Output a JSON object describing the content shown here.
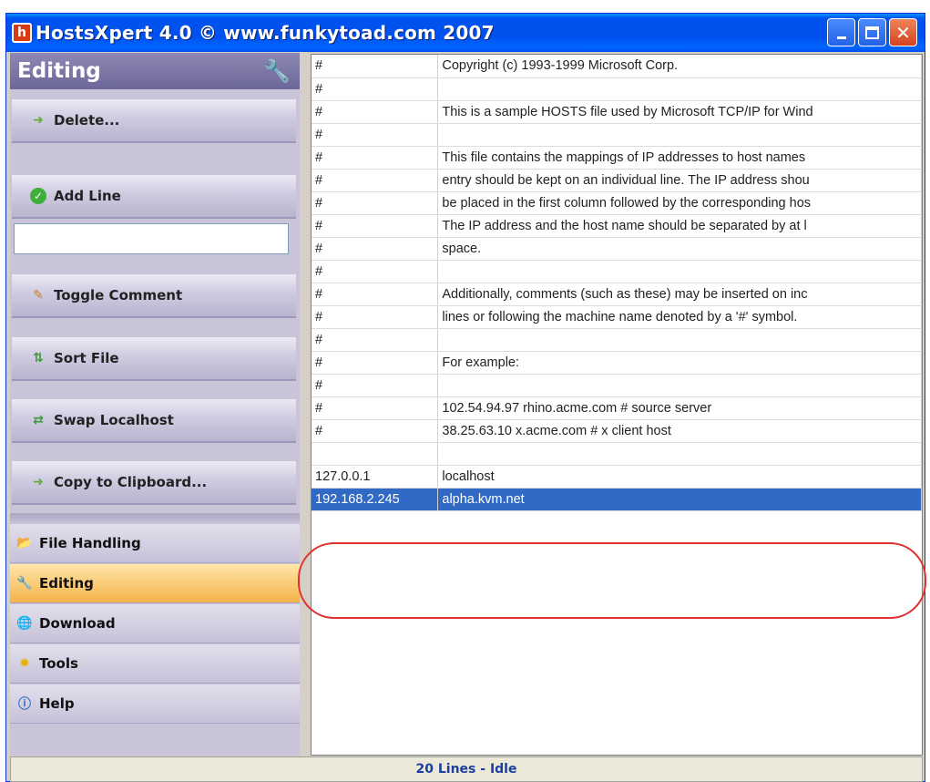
{
  "window": {
    "title": "HostsXpert 4.0 © www.funkytoad.com 2007"
  },
  "sidebar": {
    "header": "Editing",
    "actions": [
      {
        "label": "Delete...",
        "icon": "arrow-right-icon"
      },
      {
        "label": "Add Line",
        "icon": "check-circle-icon"
      },
      {
        "label": "Toggle Comment",
        "icon": "pencil-icon"
      },
      {
        "label": "Sort File",
        "icon": "sort-icon"
      },
      {
        "label": "Swap Localhost",
        "icon": "swap-icon"
      },
      {
        "label": "Copy to Clipboard...",
        "icon": "arrow-right-icon"
      }
    ],
    "add_input_value": "",
    "nav": [
      {
        "label": "File Handling",
        "icon": "folder-icon"
      },
      {
        "label": "Editing",
        "icon": "wrench-icon",
        "active": true
      },
      {
        "label": "Download",
        "icon": "globe-icon"
      },
      {
        "label": "Tools",
        "icon": "star-icon"
      },
      {
        "label": "Help",
        "icon": "help-icon"
      }
    ]
  },
  "hosts_rows": [
    [
      "#",
      "Copyright (c) 1993-1999 Microsoft Corp."
    ],
    [
      "#",
      ""
    ],
    [
      "#",
      "This is a sample HOSTS file used by Microsoft TCP/IP for Wind"
    ],
    [
      "#",
      ""
    ],
    [
      "#",
      "This file contains the mappings of IP addresses to host names"
    ],
    [
      "#",
      "entry should be kept on an individual line. The IP address shou"
    ],
    [
      "#",
      "be placed in the first column followed by the corresponding hos"
    ],
    [
      "#",
      "The IP address and the host name should be separated by at l"
    ],
    [
      "#",
      "space."
    ],
    [
      "#",
      ""
    ],
    [
      "#",
      "Additionally, comments (such as these) may be inserted on inc"
    ],
    [
      "#",
      "lines or following the machine name denoted by a '#' symbol."
    ],
    [
      "#",
      ""
    ],
    [
      "#",
      "For example:"
    ],
    [
      "#",
      ""
    ],
    [
      "#",
      "102.54.94.97     rhino.acme.com          # source server"
    ],
    [
      "#",
      "38.25.63.10     x.acme.com              # x client host"
    ],
    [
      "",
      ""
    ],
    [
      "127.0.0.1",
      "localhost"
    ],
    [
      "192.168.2.245",
      "alpha.kvm.net"
    ]
  ],
  "selected_row": 19,
  "status": "20 Lines - Idle",
  "colors": {
    "selection": "#316ac5",
    "highlight_ring": "#e03030"
  }
}
